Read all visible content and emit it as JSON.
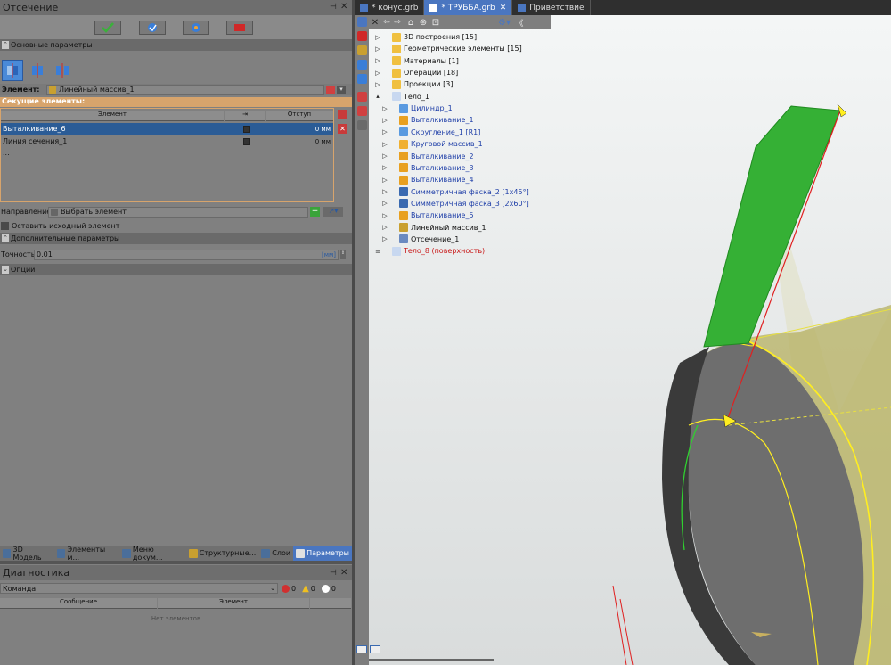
{
  "left_panel": {
    "title": "Отсечение",
    "pin": "⊣",
    "close": "✕",
    "basic_section": "Основные параметры",
    "element_label": "Элемент:",
    "element_value": "Линейный массив_1",
    "cutting_label": "Секущие элементы:",
    "grid_headers": {
      "element": "Элемент",
      "offset": "Отступ"
    },
    "grid_rows": [
      {
        "name": "Выталкивание_6",
        "offset": "0 мм"
      },
      {
        "name": "Линия сечения_1",
        "offset": "0 мм"
      },
      {
        "name": "...",
        "offset": ""
      }
    ],
    "direction_label": "Направление:",
    "direction_value": "Выбрать элемент",
    "keep_source": "Оставить исходный элемент",
    "extra_section": "Дополнительные параметры",
    "accuracy_label": "Точность:",
    "accuracy_value": "0.01",
    "accuracy_unit": "[мм]",
    "options_section": "Опции"
  },
  "bottom_tabs": [
    "3D Модель",
    "Элементы м...",
    "Меню докум...",
    "Структурные...",
    "Слои",
    "Параметры"
  ],
  "diagnostics": {
    "title": "Диагностика",
    "filter": "Команда",
    "errors": "0",
    "warnings": "0",
    "infos": "0",
    "col_message": "Сообщение",
    "col_element": "Элемент",
    "empty": "Нет элементов"
  },
  "doc_tabs": [
    {
      "label": "* конус.grb",
      "active": false
    },
    {
      "label": "* ТРУББА.grb",
      "active": true
    },
    {
      "label": "Приветствие",
      "active": false
    }
  ],
  "tree": [
    {
      "label": "3D построения [15]",
      "indent": 0,
      "style": "normal",
      "icon": "folder"
    },
    {
      "label": "Геометрические элементы [15]",
      "indent": 0,
      "style": "normal",
      "icon": "folder"
    },
    {
      "label": "Материалы [1]",
      "indent": 0,
      "style": "normal",
      "icon": "folder"
    },
    {
      "label": "Операции [18]",
      "indent": 0,
      "style": "normal",
      "icon": "folder"
    },
    {
      "label": "Проекции [3]",
      "indent": 0,
      "style": "normal",
      "icon": "folder"
    },
    {
      "label": "Тело_1",
      "indent": 0,
      "style": "normal",
      "icon": "body"
    },
    {
      "label": "Цилиндр_1",
      "indent": 1,
      "style": "blue",
      "icon": "cyl"
    },
    {
      "label": "Выталкивание_1",
      "indent": 1,
      "style": "blue",
      "icon": "extrude"
    },
    {
      "label": "Скругление_1 [R1]",
      "indent": 1,
      "style": "blue",
      "icon": "fillet"
    },
    {
      "label": "Круговой массив_1",
      "indent": 1,
      "style": "blue",
      "icon": "array"
    },
    {
      "label": "Выталкивание_2",
      "indent": 1,
      "style": "blue",
      "icon": "extrude"
    },
    {
      "label": "Выталкивание_3",
      "indent": 1,
      "style": "blue",
      "icon": "extrude"
    },
    {
      "label": "Выталкивание_4",
      "indent": 1,
      "style": "blue",
      "icon": "extrude"
    },
    {
      "label": "Симметричная фаска_2 [1x45°]",
      "indent": 1,
      "style": "blue",
      "icon": "chamfer"
    },
    {
      "label": "Симметричная фаска_3 [2x60°]",
      "indent": 1,
      "style": "blue",
      "icon": "chamfer"
    },
    {
      "label": "Выталкивание_5",
      "indent": 1,
      "style": "blue",
      "icon": "extrude"
    },
    {
      "label": "Линейный массив_1",
      "indent": 1,
      "style": "normal",
      "icon": "linarray"
    },
    {
      "label": "Отсечение_1",
      "indent": 1,
      "style": "normal",
      "icon": "cut"
    },
    {
      "label": "Тело_8 (поверхность)",
      "indent": 0,
      "style": "red",
      "icon": "surface"
    }
  ]
}
